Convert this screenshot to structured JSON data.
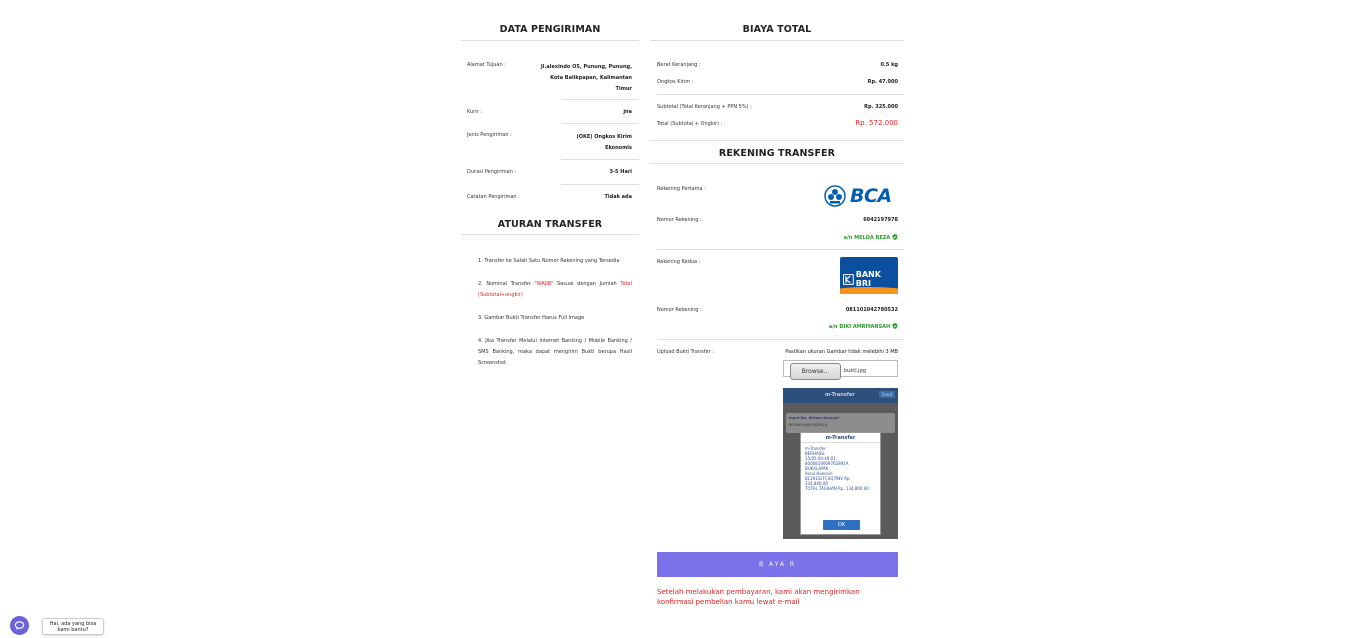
{
  "shipping": {
    "title": "DATA PENGIRIMAN",
    "address_label": "Alamat Tujuan :",
    "address_lines": [
      "Jl.alexindo O5, Punung, Punung,",
      "Kota Balikpapan, Kalimantan",
      "Timur"
    ],
    "courier_label": "Kurir :",
    "courier_value": "jne",
    "service_label": "Jenis Pengiriman :",
    "service_lines": [
      "(OKE) Ongkos Kirim",
      "Ekonomis"
    ],
    "duration_label": "Durasi Pengiriman :",
    "duration_value": "3-5 Hari",
    "note_label": "Catatan Pengiriman :",
    "note_value": "Tidak ada"
  },
  "rules": {
    "title": "ATURAN TRANSFER",
    "item1": "1. Transfer ke Salah Satu Nomor Rekening yang Tersedia",
    "item2_a": "2. Nominal Transfer ",
    "item2_b": "\"WAJIB\"",
    "item2_c": " Sesuai dengan Jumlah ",
    "item2_d": "Total (Subtotal+ongkir)",
    "item3": "3. Gambar Bukti Transfer Harus Full Image",
    "item4": "4. Jika Transfer Melalui Internet Banking / Mobile Banking / SMS Banking, maka dapat mengirim Bukti berupa Hasil Screenshot"
  },
  "totals": {
    "title": "BIAYA TOTAL",
    "weight_label": "Berat Keranjang :",
    "weight_value": "0.5 kg",
    "shipping_label": "Ongkos Kirim :",
    "shipping_value": "Rp. 47.000",
    "subtotal_label": "Subtotal (Total Keranjang + PPN 5%) :",
    "subtotal_value": "Rp. 325.000",
    "total_label": "Total (Subtotal + Ongkir) :",
    "total_value": "Rp. 572.000"
  },
  "transfer": {
    "title": "REKENING TRANSFER",
    "first_label": "Rekening Pertama :",
    "first_logo": "BCA",
    "first_number_label": "Nomor Rekening :",
    "first_number": "6042197978",
    "first_owner": "a/n MELDA REZA",
    "second_label": "Rekening Kedua :",
    "second_logo": "BANK BRI",
    "second_number_label": "Nomor Rekening :",
    "second_number": "081101042780532",
    "second_owner": "a/n DIKI AMRIYANSAH",
    "upload_label": "Upload Bukti Transfer :",
    "upload_hint": "Pastikan ukuran Gambar tidak melebihi 3 MB",
    "browse_label": "Browse...",
    "file_name": "bukti.jpg"
  },
  "proof": {
    "header": "m-Transfer",
    "send_label": "Send",
    "field_label": "Input No. Virtual Account",
    "field_value": "8000819009762891A",
    "dialog_title": "m-Transfer",
    "dialog_lines": [
      "m-Transfer",
      "BERHASIL",
      "15/05 00:49:01",
      "8000819009762891A",
      "BUKALAPAK",
      "Asrul Hoesein",
      "BL19132FCSQ7INV Rp.",
      "134,800.00",
      "TOTAL TAGIHAN Rp. 134,800.00"
    ],
    "ok_label": "OK"
  },
  "pay_button": "B AYA R",
  "confirmation": "Setelah melakukan pembayaran, kami akan mengirimkan konfirmasi pembelian kamu lewat e-mail",
  "chat": {
    "tip_line1": "Hai, ada yang bisa",
    "tip_line2": "kami bantu?"
  },
  "colors": {
    "accent": "#7b72e9",
    "total_red": "#e52222",
    "owner_green": "#2a9d2a",
    "bri_blue": "#0b4f9f",
    "bca_blue": "#0060af"
  }
}
